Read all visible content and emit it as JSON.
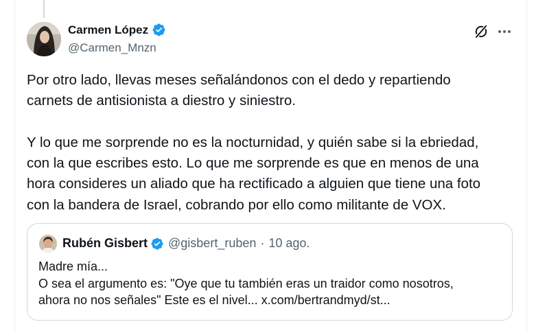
{
  "colors": {
    "verified_blue": "#1d9bf0",
    "text_primary": "#0f1419",
    "text_secondary": "#536471",
    "border": "#cfd9de"
  },
  "tweet": {
    "author": {
      "name": "Carmen López",
      "handle": "@Carmen_Mnzn",
      "verified": true
    },
    "text": "Por otro lado, llevas meses señalándonos con el dedo y repartiendo\ncarnets de antisionista a diestro y siniestro.\n\nY lo que me sorprende no es la nocturnidad, y quién sabe si la ebriedad,\ncon la que escribes esto. Lo que me sorprende es que en menos de una\nhora consideres un aliado que ha rectificado a alguien que tiene una foto\ncon la bandera de Israel, cobrando por ello como militante de VOX.",
    "icons": [
      "grok-icon",
      "more-options-icon"
    ]
  },
  "quoted_tweet": {
    "author": {
      "name": "Rubén Gisbert",
      "handle": "@gisbert_ruben",
      "verified": true
    },
    "separator": "·",
    "date": "10 ago.",
    "text": "Madre mía...\nO sea el argumento es: \"Oye que tu también eras un traidor como nosotros,\nahora no nos señales\" Este es el nivel... x.com/bertrandmyd/st..."
  }
}
